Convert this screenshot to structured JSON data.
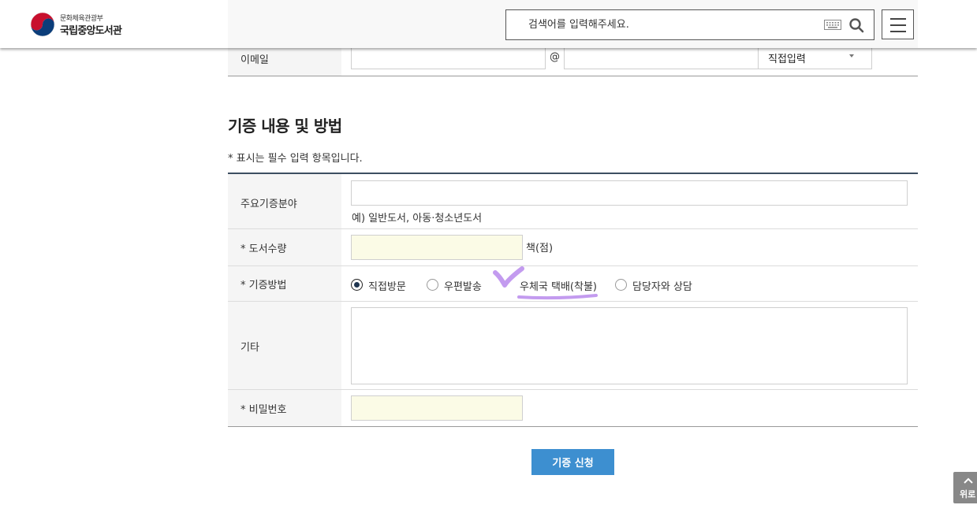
{
  "header": {
    "logo_sub": "문화체육관광부",
    "logo_main": "국립중앙도서관",
    "search_placeholder": "검색어를 입력해주세요.",
    "icons": [
      "keyboard-icon",
      "search-icon",
      "hamburger-menu-icon"
    ]
  },
  "email_row": {
    "label": "이메일",
    "at_symbol": "@",
    "domain_select_value": "직접입력"
  },
  "section": {
    "title": "기증 내용 및 방법",
    "required_note": "* 표시는 필수 입력 항목입니다."
  },
  "form": {
    "field_label": "주요기증분야",
    "field_hint": "예) 일반도서, 아동·청소년도서",
    "quantity_label": "* 도서수량",
    "quantity_unit": "책(점)",
    "method_label": "* 기증방법",
    "method_options": [
      "직접방문",
      "우편발송",
      "우체국 택배(착불)",
      "담당자와 상담"
    ],
    "method_selected": "직접방문",
    "etc_label": "기타",
    "password_label": "* 비밀번호"
  },
  "annotation": {
    "highlight_color": "#c39bef"
  },
  "actions": {
    "submit_label": "기증 신청",
    "top_label": "위로"
  },
  "colors": {
    "table_top_border": "#3d4e61",
    "submit_bg": "#3d8fd0",
    "required_field_bg": "#fbfbe6",
    "radio_checked": "#1f3550"
  }
}
